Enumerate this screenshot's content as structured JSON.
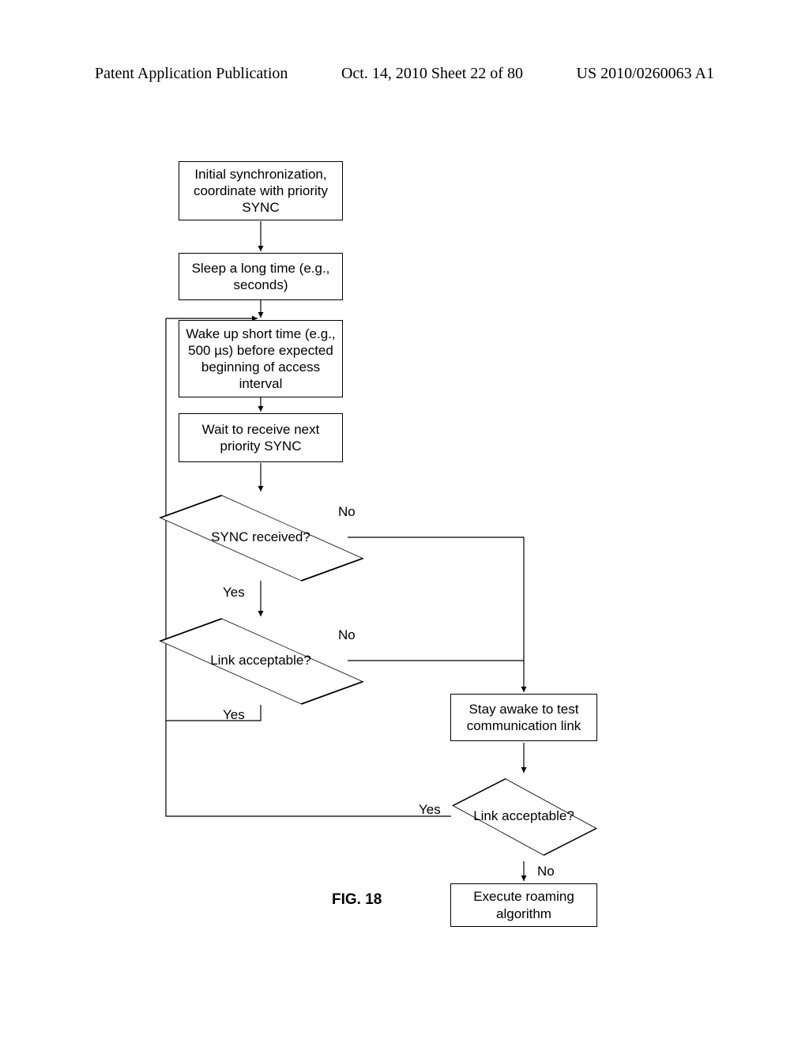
{
  "header": {
    "left": "Patent Application Publication",
    "center": "Oct. 14, 2010  Sheet 22 of 80",
    "right": "US 2010/0260063 A1"
  },
  "boxes": {
    "init_sync": "Initial synchronization, coordinate with priority SYNC",
    "sleep": "Sleep a long time (e.g., seconds)",
    "wake": "Wake up short time (e.g., 500 µs) before expected beginning of access interval",
    "wait": "Wait to receive next priority SYNC",
    "stay_awake": "Stay awake to test communication link",
    "roaming": "Execute roaming algorithm"
  },
  "decisions": {
    "sync_received": "SYNC received?",
    "link_acceptable_1": "Link acceptable?",
    "link_acceptable_2": "Link acceptable?"
  },
  "edges": {
    "no": "No",
    "yes": "Yes"
  },
  "figure_label": "FIG. 18"
}
